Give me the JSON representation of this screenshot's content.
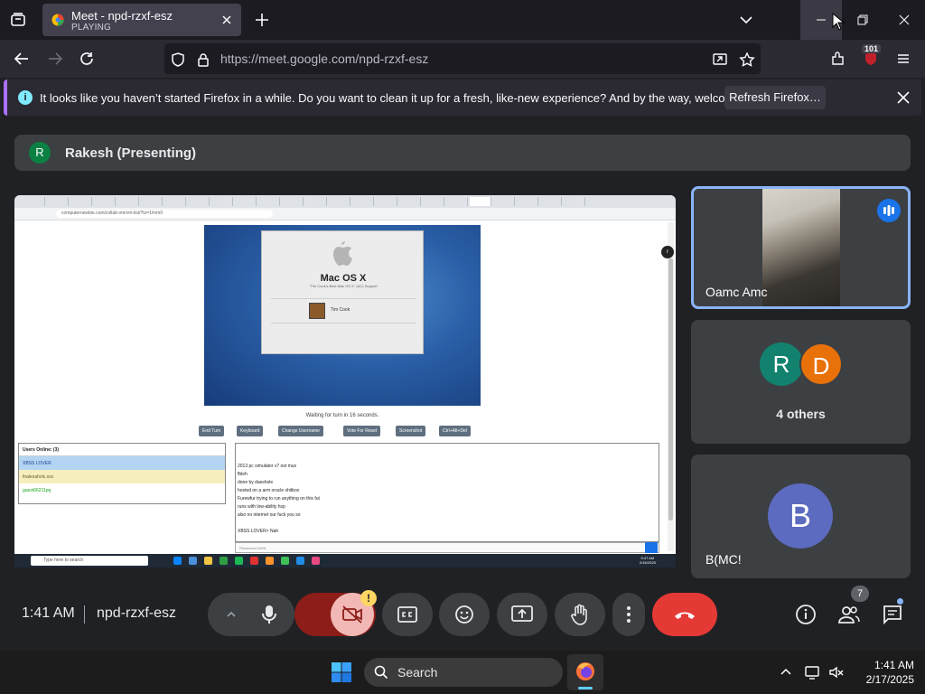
{
  "browser": {
    "tab": {
      "title": "Meet - npd-rzxf-esz",
      "status": "PLAYING"
    },
    "url": "https://meet.google.com/npd-rzxf-esz",
    "extension_badge": "101"
  },
  "notification": {
    "message": "It looks like you haven’t started Firefox in a while. Do you want to clean it up for a fresh, like-new experience? And by the way, welcome back!",
    "button": "Refresh Firefox…"
  },
  "presenter": {
    "initial": "R",
    "name": "Rakesh (Presenting)"
  },
  "shared_screen": {
    "address": "computernewbie.com/collab-vm/vm-list/?ts=1#vm0",
    "vm": {
      "os_name": "Mac OS X",
      "tagline": "\"Tim Cook's Best Mac OS X\" (AC) Support",
      "user": "Tim Cook"
    },
    "wait_text": "Waiting for turn in 16 seconds.",
    "buttons": [
      "End Turn",
      "Keyboard",
      "Change Username",
      "Vote For Reset",
      "Screenshot",
      "Ctrl+Alt+Del"
    ],
    "users_header": "Users Online: (3)",
    "users": [
      {
        "name": "XBSS LOVER",
        "color": "#1a3f8a",
        "bg": "#b3d5f3"
      },
      {
        "name": "fnalexaholc.sss",
        "color": "#6a5a2a",
        "bg": "#f6eebc"
      },
      {
        "name": "guest66211pq",
        "color": "#1aa41a",
        "bg": "#ffffff"
      }
    ],
    "chat_lines": [
      "2013 pc simulator v7 ost mus",
      "fbleh",
      "done by dasshole",
      "hosted on a arm oracle shitbox",
      "Furewfur trying to run anything on this fut",
      "runs with low-ability hsp",
      "also no internet our fuck you so",
      "",
      "XBSS LOVER> Nah"
    ],
    "chat_placeholder": "Rbwsucks,for!NI",
    "taskbar_search": "Type here to search",
    "taskbar_time": "9:47 AM",
    "taskbar_date": "2/16/2025"
  },
  "participants": {
    "tile1": {
      "name": "Oamc Amc"
    },
    "tile2": {
      "avatars": [
        "R",
        "D"
      ],
      "count_label": "4 others"
    },
    "tile3": {
      "initial": "B",
      "name": "B(MC!"
    }
  },
  "controls": {
    "time": "1:41 AM",
    "meeting_code": "npd-rzxf-esz",
    "people_count": "7",
    "camera_warning": "!"
  },
  "taskbar": {
    "search_label": "Search",
    "time": "1:41 AM",
    "date": "2/17/2025"
  }
}
